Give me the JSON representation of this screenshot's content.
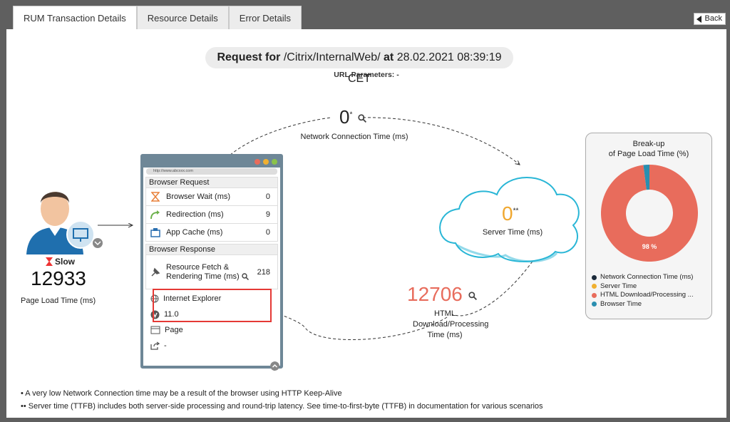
{
  "tabs": [
    {
      "label": "RUM Transaction Details",
      "active": true
    },
    {
      "label": "Resource Details",
      "active": false
    },
    {
      "label": "Error Details",
      "active": false
    }
  ],
  "back_label": "Back",
  "request": {
    "prefix": "Request for",
    "path": "/Citrix/InternalWeb/",
    "at": "at",
    "timestamp": "28.02.2021 08:39:19 CET"
  },
  "url_params": "URL Parameters: -",
  "user": {
    "status": "Slow",
    "page_load_time": "12933",
    "page_load_label": "Page Load Time (ms)"
  },
  "browser": {
    "url": "http://www.abcxxx.com",
    "request_title": "Browser Request",
    "request_rows": [
      {
        "label": "Browser Wait (ms)",
        "value": "0",
        "icon": "hourglass-icon"
      },
      {
        "label": "Redirection (ms)",
        "value": "9",
        "icon": "redirect-arrow-icon"
      },
      {
        "label": "App Cache (ms)",
        "value": "0",
        "icon": "app-cache-icon"
      }
    ],
    "response_title": "Browser Response",
    "response_row": {
      "label": "Resource Fetch & Rendering Time (ms)",
      "value": "218",
      "icon": "pin-icon"
    },
    "browser_name": "Internet Explorer",
    "browser_version": "11.0",
    "page_label": "Page",
    "share_value": "-"
  },
  "network": {
    "value": "0",
    "mark": "*",
    "label": "Network Connection Time (ms)"
  },
  "server": {
    "value": "0",
    "mark": "**",
    "label": "Server Time (ms)"
  },
  "html": {
    "value": "12706",
    "label": "HTML Download/Processing Time (ms)"
  },
  "breakup": {
    "title_line1": "Break-up",
    "title_line2": "of Page Load Time (%)",
    "center_label": "98 %",
    "legend": [
      {
        "label": "Network Connection Time (ms)",
        "color": "#1b2a3a"
      },
      {
        "label": "Server Time",
        "color": "#f0b030"
      },
      {
        "label": "HTML Download/Processing ...",
        "color": "#e86c5c"
      },
      {
        "label": "Browser Time",
        "color": "#2a8fb0"
      }
    ],
    "slices": [
      {
        "name": "Network Connection Time (ms)",
        "percent": 0
      },
      {
        "name": "Server Time",
        "percent": 0
      },
      {
        "name": "HTML Download/Processing ...",
        "percent": 98
      },
      {
        "name": "Browser Time",
        "percent": 2
      }
    ]
  },
  "notes": [
    "• A very low Network Connection time may be a result of the browser using HTTP Keep-Alive",
    "•• Server time (TTFB) includes both server-side processing and round-trip latency. See time-to-first-byte (TTFB) in documentation for various scenarios"
  ]
}
